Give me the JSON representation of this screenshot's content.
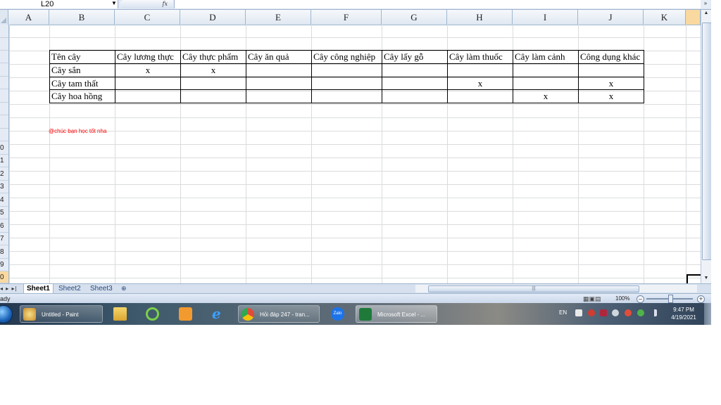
{
  "name_box": {
    "value": "L20"
  },
  "formula_bar": {
    "fx_label": "fx",
    "formula": ""
  },
  "columns": [
    "A",
    "B",
    "C",
    "D",
    "E",
    "F",
    "G",
    "H",
    "I",
    "J",
    "K"
  ],
  "rows": [
    "",
    "",
    "",
    "",
    "",
    "",
    "",
    "",
    "",
    "0",
    "1",
    "2",
    "3",
    "4",
    "5",
    "6",
    "7",
    "8",
    "9",
    "0"
  ],
  "table": {
    "headers": [
      "Tên cây",
      "Cây lương thực",
      "Cây thực phẩm",
      "Cây ăn quả",
      "Cây công nghiệp",
      "Cây lấy gỗ",
      "Cây làm thuốc",
      "Cây làm cảnh",
      "Công dụng khác"
    ],
    "rows": [
      [
        "Cây sắn",
        "x",
        "x",
        "",
        "",
        "",
        "",
        "",
        ""
      ],
      [
        "Cây tam thất",
        "",
        "",
        "",
        "",
        "",
        "x",
        "",
        "x"
      ],
      [
        "Cây hoa hồng",
        "",
        "",
        "",
        "",
        "",
        "",
        "x",
        "x"
      ]
    ]
  },
  "note": "@chúc bạn học tốt nha",
  "sheets": [
    "Sheet1",
    "Sheet2",
    "Sheet3"
  ],
  "active_sheet": "Sheet1",
  "status": {
    "text": "ady",
    "zoom": "100%"
  },
  "taskbar": {
    "buttons": [
      {
        "label": "Untitled - Paint",
        "icon": "paint-icon"
      },
      {
        "label": "Hỏi đáp 247 - tran...",
        "icon": "chrome-icon"
      },
      {
        "label": "Zalo",
        "icon": "zalo-icon"
      },
      {
        "label": "Microsoft Excel - ...",
        "icon": "excel-icon"
      }
    ],
    "pinned": [
      "file-explorer-icon",
      "chrome-green-icon",
      "media-player-icon",
      "internet-explorer-icon"
    ],
    "language": "EN",
    "time": "9:47 PM",
    "date": "4/19/2021"
  }
}
